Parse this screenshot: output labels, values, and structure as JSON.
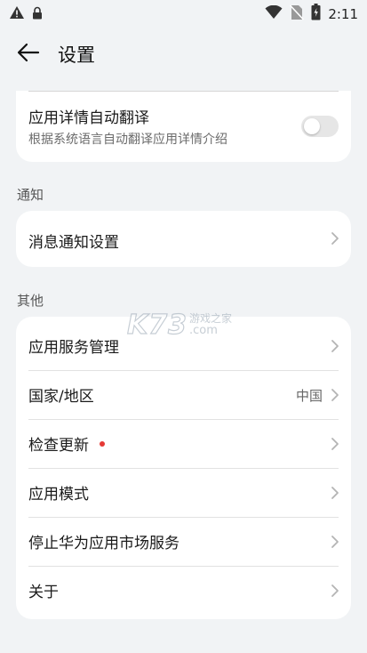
{
  "status_bar": {
    "time": "2:11",
    "icons": [
      "warning-icon",
      "lock-icon",
      "wifi-icon",
      "no-sim-icon",
      "battery-icon"
    ]
  },
  "header": {
    "title": "设置"
  },
  "auto_translate": {
    "label": "应用详情自动翻译",
    "description": "根据系统语言自动翻译应用详情介绍",
    "toggle_on": false
  },
  "sections": {
    "notifications": {
      "label": "通知",
      "item": "消息通知设置"
    },
    "other": {
      "label": "其他",
      "items": [
        {
          "label": "应用服务管理",
          "value": ""
        },
        {
          "label": "国家/地区",
          "value": "中国"
        },
        {
          "label": "检查更新",
          "value": "",
          "badge": true
        },
        {
          "label": "应用模式",
          "value": ""
        },
        {
          "label": "停止华为应用市场服务",
          "value": ""
        },
        {
          "label": "关于",
          "value": ""
        }
      ]
    }
  },
  "watermark": {
    "brand": "K73",
    "sub": "游戏之家",
    "domain": ".com"
  },
  "colors": {
    "background": "#f1f3f5",
    "card": "#ffffff",
    "badge": "#e53935"
  }
}
